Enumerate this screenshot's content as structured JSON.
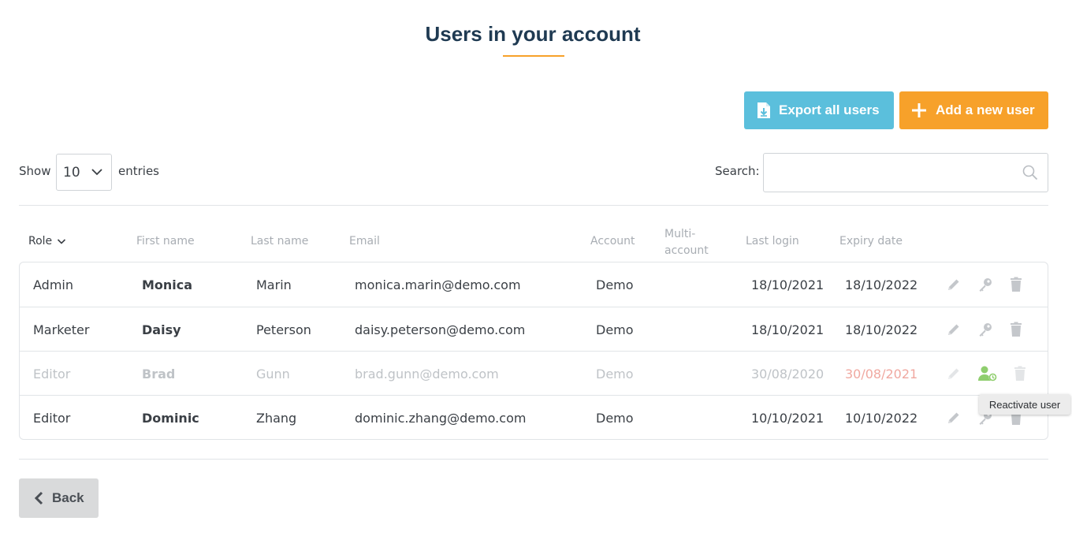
{
  "page": {
    "title": "Users in your account"
  },
  "toolbar": {
    "export_label": "Export all users",
    "add_label": "Add a new user"
  },
  "length_menu": {
    "show": "Show",
    "value": "10",
    "entries": "entries"
  },
  "search": {
    "label": "Search:",
    "value": "",
    "placeholder": ""
  },
  "table": {
    "columns": {
      "role": "Role",
      "first_name": "First name",
      "last_name": "Last name",
      "email": "Email",
      "account": "Account",
      "multi_account_1": "Multi-",
      "multi_account_2": "account",
      "last_login": "Last login",
      "expiry_date": "Expiry date"
    },
    "rows": [
      {
        "role": "Admin",
        "first_name": "Monica",
        "last_name": "Marin",
        "email": "monica.marin@demo.com",
        "account": "Demo",
        "multi_account": "",
        "last_login": "18/10/2021",
        "expiry_date": "18/10/2022",
        "status": "active"
      },
      {
        "role": "Marketer",
        "first_name": "Daisy",
        "last_name": "Peterson",
        "email": "daisy.peterson@demo.com",
        "account": "Demo",
        "multi_account": "",
        "last_login": "18/10/2021",
        "expiry_date": "18/10/2022",
        "status": "active"
      },
      {
        "role": "Editor",
        "first_name": "Brad",
        "last_name": "Gunn",
        "email": "brad.gunn@demo.com",
        "account": "Demo",
        "multi_account": "",
        "last_login": "30/08/2020",
        "expiry_date": "30/08/2021",
        "status": "inactive"
      },
      {
        "role": "Editor",
        "first_name": "Dominic",
        "last_name": "Zhang",
        "email": "dominic.zhang@demo.com",
        "account": "Demo",
        "multi_account": "",
        "last_login": "10/10/2021",
        "expiry_date": "10/10/2022",
        "status": "active"
      }
    ],
    "row_actions": [
      "pencil-icon",
      "key-icon",
      "trash-icon"
    ],
    "inactive_actions": [
      "pencil-icon",
      "user-reactivate-icon",
      "trash-icon"
    ]
  },
  "tooltip": {
    "text": "Reactivate user"
  },
  "footer": {
    "back_label": "Back"
  },
  "colors": {
    "title": "#1f3a52",
    "accent_orange": "#f7a12a",
    "export_blue": "#5bbfdc",
    "reactivate_green": "#8fce6e",
    "expired_red": "#f0a8a0"
  }
}
